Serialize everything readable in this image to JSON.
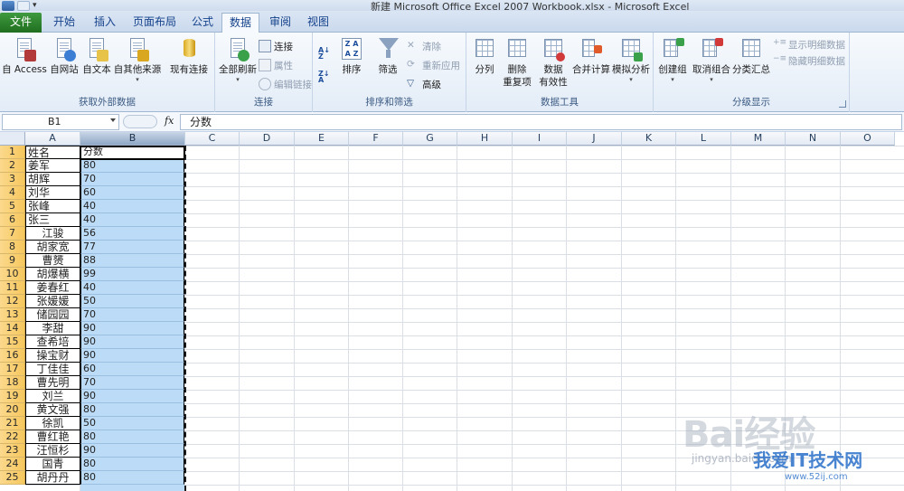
{
  "window": {
    "title": "新建 Microsoft Office Excel 2007 Workbook.xlsx  -  Microsoft Excel"
  },
  "tabs": [
    {
      "label": "文件"
    },
    {
      "label": "开始"
    },
    {
      "label": "插入"
    },
    {
      "label": "页面布局"
    },
    {
      "label": "公式"
    },
    {
      "label": "数据"
    },
    {
      "label": "审阅"
    },
    {
      "label": "视图"
    }
  ],
  "active_tab": "数据",
  "ribbon": {
    "get_external": {
      "label": "获取外部数据",
      "buttons": [
        "自 Access",
        "自网站",
        "自文本",
        "自其他来源",
        "现有连接"
      ]
    },
    "connections": {
      "label": "连接",
      "refresh_all": "全部刷新",
      "small": [
        "连接",
        "属性",
        "编辑链接"
      ]
    },
    "sort_filter": {
      "label": "排序和筛选",
      "sort": "排序",
      "filter": "筛选",
      "small": [
        "清除",
        "重新应用",
        "高级"
      ]
    },
    "data_tools": {
      "label": "数据工具",
      "buttons": [
        "分列",
        "删除\n重复项",
        "数据\n有效性",
        "合并计算",
        "模拟分析"
      ],
      "remove_dup_line1": "删除",
      "remove_dup_line2": "重复项",
      "validation_line1": "数据",
      "validation_line2": "有效性"
    },
    "outline": {
      "label": "分级显示",
      "buttons": [
        "创建组",
        "取消组合",
        "分类汇总"
      ],
      "small": [
        "显示明细数据",
        "隐藏明细数据"
      ]
    }
  },
  "formula_bar": {
    "name_box": "B1",
    "fx": "fx",
    "value": "分数"
  },
  "columns": [
    "A",
    "B",
    "C",
    "D",
    "E",
    "F",
    "G",
    "H",
    "I",
    "J",
    "K",
    "L",
    "M",
    "N",
    "O"
  ],
  "rows": [
    {
      "n": "1",
      "a": "姓名",
      "b": "分数"
    },
    {
      "n": "2",
      "a": "姜军",
      "b": "80"
    },
    {
      "n": "3",
      "a": "胡辉",
      "b": "70"
    },
    {
      "n": "4",
      "a": "刘华",
      "b": "60"
    },
    {
      "n": "5",
      "a": "张峰",
      "b": "40"
    },
    {
      "n": "6",
      "a": "张三",
      "b": "40"
    },
    {
      "n": "7",
      "a": "江骏",
      "b": "56"
    },
    {
      "n": "8",
      "a": "胡家宽",
      "b": "77"
    },
    {
      "n": "9",
      "a": "曹赟",
      "b": "88"
    },
    {
      "n": "10",
      "a": "胡爆横",
      "b": "99"
    },
    {
      "n": "11",
      "a": "姜春红",
      "b": "40"
    },
    {
      "n": "12",
      "a": "张媛媛",
      "b": "50"
    },
    {
      "n": "13",
      "a": "储园园",
      "b": "70"
    },
    {
      "n": "14",
      "a": "李甜",
      "b": "90"
    },
    {
      "n": "15",
      "a": "查希培",
      "b": "90"
    },
    {
      "n": "16",
      "a": "操宝财",
      "b": "90"
    },
    {
      "n": "17",
      "a": "丁佳佳",
      "b": "60"
    },
    {
      "n": "18",
      "a": "曹先明",
      "b": "70"
    },
    {
      "n": "19",
      "a": "刘兰",
      "b": "90"
    },
    {
      "n": "20",
      "a": "黄文强",
      "b": "80"
    },
    {
      "n": "21",
      "a": "徐凯",
      "b": "50"
    },
    {
      "n": "22",
      "a": "曹红艳",
      "b": "80"
    },
    {
      "n": "23",
      "a": "汪恒杉",
      "b": "90"
    },
    {
      "n": "24",
      "a": "国青",
      "b": "80"
    },
    {
      "n": "25",
      "a": "胡丹丹",
      "b": "80"
    }
  ],
  "watermark": {
    "baidu": "Bai经验",
    "jingyan": "jingyan.baidu.com",
    "site": "我爱IT技术网",
    "url": "www.52ij.com"
  },
  "colors": {
    "selection": "#bcdbf6",
    "row_header": "#f6c75e",
    "file_tab": "#2f8a2f"
  }
}
